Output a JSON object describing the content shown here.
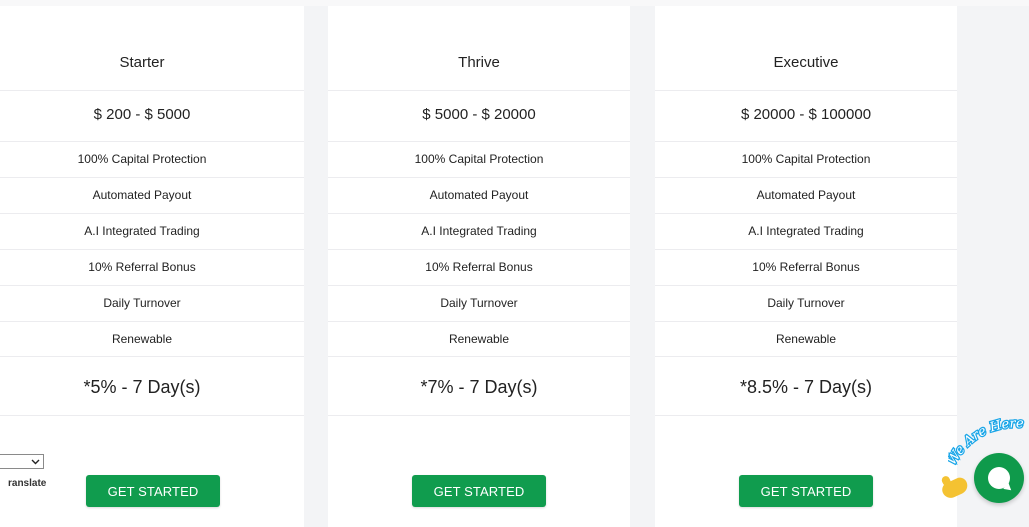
{
  "plans": [
    {
      "name": "Starter",
      "range": "$ 200 - $ 5000",
      "features": [
        "100% Capital Protection",
        "Automated Payout",
        "A.I Integrated Trading",
        "10% Referral Bonus",
        "Daily Turnover",
        "Renewable"
      ],
      "roi": "*5% - 7 Day(s)",
      "cta": "GET STARTED"
    },
    {
      "name": "Thrive",
      "range": "$ 5000 - $ 20000",
      "features": [
        "100% Capital Protection",
        "Automated Payout",
        "A.I Integrated Trading",
        "10% Referral Bonus",
        "Daily Turnover",
        "Renewable"
      ],
      "roi": "*7% - 7 Day(s)",
      "cta": "GET STARTED"
    },
    {
      "name": "Executive",
      "range": "$ 20000 - $ 100000",
      "features": [
        "100% Capital Protection",
        "Automated Payout",
        "A.I Integrated Trading",
        "10% Referral Bonus",
        "Daily Turnover",
        "Renewable"
      ],
      "roi": "*8.5% - 7 Day(s)",
      "cta": "GET STARTED"
    }
  ],
  "translate": {
    "label": "ranslate",
    "select_arrow": "chevron-down-icon"
  },
  "chat_widget": {
    "text": "We Are Here",
    "icons": [
      "waving-hand-icon",
      "chat-bubble-icon"
    ]
  },
  "colors": {
    "accent": "#109c4e",
    "card_bg": "#ffffff",
    "page_bg": "#f3f4f6",
    "chat_bg": "#0f9a4b"
  }
}
